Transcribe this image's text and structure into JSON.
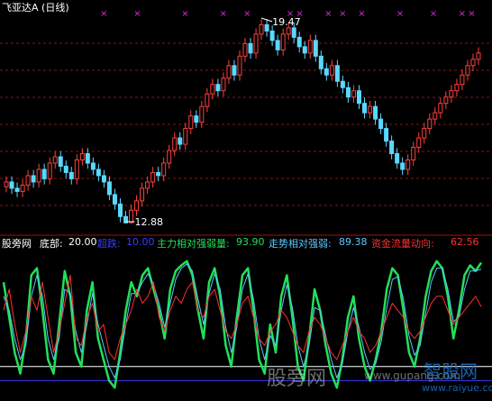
{
  "title": "飞亚达A (日线)",
  "price_high_label": "19.47",
  "price_low_label": "12.88",
  "indicator": {
    "name": "股旁网",
    "bottom": {
      "label": "底部:",
      "value": "20.00",
      "color": "#ffffff"
    },
    "overbought": {
      "label": "超跌:",
      "value": "10.00",
      "color": "#3b3bff"
    },
    "main_rs": {
      "label": "主力相对强弱量:",
      "value": "93.90",
      "color": "#22e05a"
    },
    "trend_rs": {
      "label": "走势相对强弱:",
      "value": "89.38",
      "color": "#5ac8ff"
    },
    "flow": {
      "label": "资金流量动向:",
      "value": "62.56",
      "color": "#ff3030"
    }
  },
  "watermark": {
    "text1": "股旁网",
    "text2": "www.gupang.com",
    "text3": "智股网",
    "text4": "www.raiyue.com"
  },
  "chart_data": [
    {
      "type": "candlestick",
      "title": "飞亚达A (日线)",
      "y_range": [
        12.88,
        19.47
      ],
      "annotations": [
        {
          "text": "19.47",
          "kind": "high"
        },
        {
          "text": "12.88",
          "kind": "low"
        }
      ],
      "colors": {
        "up": "#ff4040",
        "down": "#5ad8ff"
      },
      "close": [
        14.2,
        14.0,
        13.9,
        14.1,
        14.4,
        14.2,
        14.6,
        14.3,
        14.8,
        15.0,
        14.7,
        14.5,
        14.3,
        14.9,
        15.1,
        14.8,
        14.6,
        14.4,
        14.2,
        13.8,
        13.5,
        13.1,
        12.9,
        13.3,
        13.6,
        14.0,
        14.2,
        14.5,
        14.4,
        14.8,
        15.2,
        15.6,
        15.4,
        15.9,
        16.3,
        16.1,
        16.6,
        17.0,
        17.3,
        17.1,
        17.5,
        17.9,
        17.6,
        18.2,
        18.6,
        18.3,
        18.9,
        19.2,
        19.0,
        18.7,
        18.4,
        18.9,
        19.1,
        18.8,
        18.5,
        18.3,
        18.7,
        18.2,
        17.8,
        17.6,
        17.9,
        17.4,
        17.2,
        16.9,
        17.1,
        16.7,
        16.4,
        16.6,
        16.2,
        15.9,
        15.5,
        15.1,
        14.8,
        14.6,
        14.9,
        15.3,
        15.6,
        15.9,
        16.2,
        16.4,
        16.7,
        16.9,
        17.1,
        17.3,
        17.6,
        17.9,
        18.1,
        18.3
      ]
    },
    {
      "type": "line",
      "y_range": [
        0,
        100
      ],
      "reference_lines": [
        {
          "name": "底部",
          "value": 20,
          "color": "#ffffff"
        },
        {
          "name": "超跌",
          "value": 10,
          "color": "#3b3bff"
        }
      ],
      "series": [
        {
          "name": "主力相对强弱量",
          "color": "#22e05a",
          "values": [
            80,
            55,
            30,
            15,
            40,
            85,
            90,
            60,
            25,
            15,
            50,
            88,
            70,
            30,
            20,
            60,
            80,
            40,
            25,
            10,
            5,
            30,
            60,
            80,
            70,
            85,
            90,
            75,
            60,
            40,
            75,
            88,
            92,
            95,
            85,
            60,
            40,
            80,
            90,
            70,
            35,
            20,
            55,
            85,
            90,
            60,
            25,
            15,
            50,
            30,
            70,
            85,
            55,
            20,
            10,
            40,
            75,
            60,
            35,
            15,
            5,
            25,
            55,
            70,
            40,
            20,
            10,
            25,
            45,
            75,
            90,
            85,
            60,
            30,
            20,
            40,
            70,
            88,
            95,
            90,
            70,
            40,
            60,
            85,
            92,
            88,
            93.9
          ]
        },
        {
          "name": "走势相对强弱",
          "color": "#5ac8ff",
          "values": [
            70,
            60,
            40,
            25,
            35,
            70,
            85,
            70,
            40,
            25,
            40,
            75,
            72,
            45,
            30,
            50,
            72,
            50,
            35,
            20,
            12,
            25,
            50,
            72,
            72,
            80,
            86,
            78,
            65,
            48,
            65,
            82,
            90,
            93,
            88,
            68,
            50,
            72,
            86,
            75,
            48,
            30,
            48,
            75,
            86,
            68,
            40,
            25,
            42,
            35,
            60,
            78,
            62,
            35,
            20,
            35,
            62,
            60,
            42,
            25,
            12,
            22,
            45,
            62,
            48,
            30,
            18,
            22,
            38,
            62,
            82,
            84,
            68,
            42,
            28,
            35,
            58,
            80,
            90,
            90,
            75,
            52,
            55,
            75,
            88,
            88,
            89.38
          ]
        },
        {
          "name": "资金流量动向",
          "color": "#ff3030",
          "values": [
            60,
            75,
            50,
            30,
            45,
            70,
            60,
            80,
            55,
            30,
            45,
            65,
            85,
            40,
            35,
            55,
            65,
            45,
            50,
            30,
            25,
            40,
            50,
            60,
            75,
            65,
            70,
            80,
            55,
            45,
            60,
            70,
            65,
            75,
            80,
            60,
            55,
            70,
            75,
            60,
            45,
            40,
            50,
            65,
            70,
            55,
            40,
            35,
            45,
            50,
            60,
            55,
            45,
            35,
            30,
            45,
            55,
            50,
            40,
            30,
            25,
            35,
            45,
            55,
            45,
            40,
            30,
            35,
            45,
            55,
            65,
            60,
            55,
            45,
            40,
            45,
            55,
            65,
            70,
            70,
            60,
            50,
            55,
            60,
            65,
            70,
            62.56
          ]
        }
      ]
    }
  ]
}
